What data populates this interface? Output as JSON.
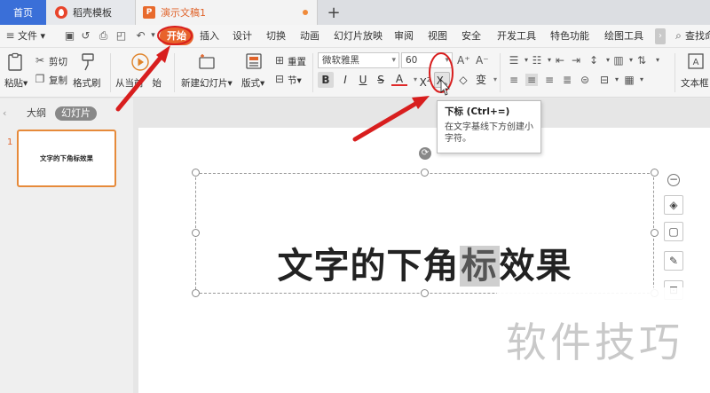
{
  "tabs": {
    "home": "首页",
    "template": "稻壳模板",
    "document": "演示文稿1"
  },
  "menu": {
    "file": "文件",
    "items": [
      "开始",
      "插入",
      "设计",
      "切换",
      "动画",
      "幻灯片放映",
      "审阅",
      "视图",
      "安全",
      "开发工具",
      "特色功能",
      "绘图工具"
    ],
    "search": "查找命"
  },
  "ribbon": {
    "paste": "粘贴",
    "cut": "剪切",
    "copy": "复制",
    "format_painter": "格式刷",
    "from_current": "从当前",
    "from_current_suffix": "始",
    "new_slide": "新建幻灯片",
    "layout": "版式",
    "reset": "重置",
    "section": "节",
    "font_name": "微软雅黑",
    "font_size": "60",
    "bold": "B",
    "italic": "I",
    "underline": "U",
    "strike": "S",
    "font_color": "A",
    "superscript": "X",
    "subscript": "X",
    "clear": "⌫",
    "change": "变",
    "text_box": "文本框"
  },
  "left_panel": {
    "outline": "大纲",
    "slides": "幻灯片",
    "slide_number": "1",
    "thumb_text": "文字的下角标效果"
  },
  "slide": {
    "text_before": "文字的下角",
    "text_highlight": "标",
    "text_after": "效果"
  },
  "tooltip": {
    "title": "下标 (Ctrl+=)",
    "description": "在文字基线下方创建小字符。"
  },
  "watermark": "软件技巧",
  "colors": {
    "accent": "#e8632c",
    "home_tab": "#3a6fd8",
    "annotation_red": "#d81e1e"
  }
}
